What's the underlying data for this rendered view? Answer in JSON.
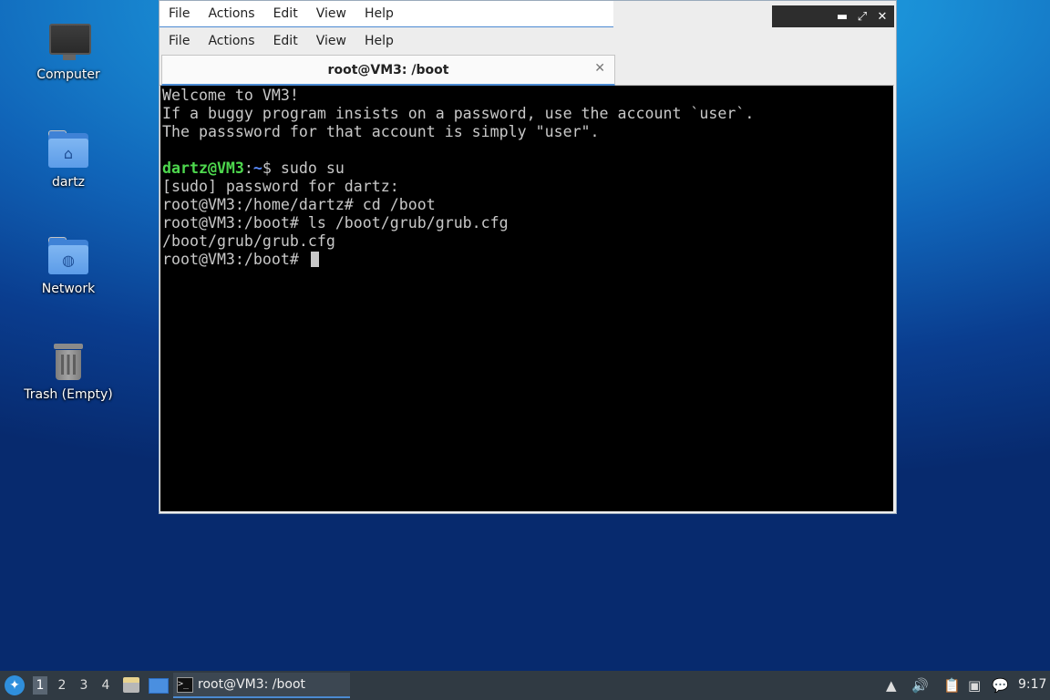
{
  "desktop": {
    "icons": [
      {
        "label": "Computer",
        "icon": "computer-icon"
      },
      {
        "label": "dartz",
        "icon": "home-folder-icon"
      },
      {
        "label": "Network",
        "icon": "network-folder-icon"
      },
      {
        "label": "Trash (Empty)",
        "icon": "trash-icon"
      }
    ]
  },
  "window": {
    "outer_menu": [
      "File",
      "Actions",
      "Edit",
      "View",
      "Help"
    ],
    "inner_menu": [
      "File",
      "Actions",
      "Edit",
      "View",
      "Help"
    ],
    "controls": {
      "minimize": "▬",
      "maximize": "⤢",
      "close": "✕"
    },
    "tab": {
      "title": "root@VM3: /boot",
      "close": "✕"
    }
  },
  "terminal": {
    "lines": [
      "Welcome to VM3!",
      "If a buggy program insists on a password, use the account `user`.",
      "The passsword for that account is simply \"user\".",
      "",
      "[sudo] password for dartz:",
      "root@VM3:/home/dartz# cd /boot",
      "root@VM3:/boot# ls /boot/grub/grub.cfg",
      "/boot/grub/grub.cfg",
      "root@VM3:/boot# "
    ],
    "colored_prompt": {
      "user_host": "dartz@VM3",
      "sep": ":",
      "path": "~",
      "rest": "$ sudo su"
    },
    "colors": {
      "bg": "#000000",
      "fg": "#c8c8c8",
      "user": "#4ed84e",
      "path": "#5b8cff"
    }
  },
  "taskbar": {
    "workspaces": [
      "1",
      "2",
      "3",
      "4"
    ],
    "active_workspace": "1",
    "task_label": "root@VM3: /boot",
    "task_icon_glyph": ">_",
    "clock": "9:17",
    "tray": {
      "updates": "▲",
      "volume": "🔊",
      "clipboard": "📋",
      "network": "▣",
      "notify": "💬"
    }
  }
}
